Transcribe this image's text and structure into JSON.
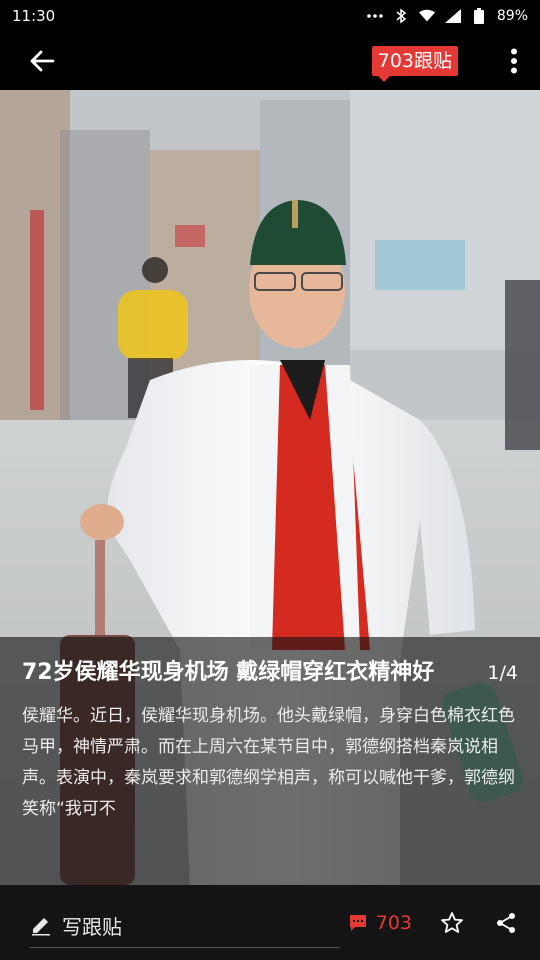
{
  "status_bar": {
    "time": "11:30",
    "battery": "89%",
    "icons": [
      "more-dots-icon",
      "bluetooth-icon",
      "wifi-icon",
      "signal-icon",
      "battery-icon"
    ]
  },
  "top_bar": {
    "back_icon": "back-arrow-icon",
    "comment_badge": "703跟贴",
    "menu_icon": "overflow-menu-icon"
  },
  "caption": {
    "title": "72岁侯耀华现身机场 戴绿帽穿红衣精神好",
    "counter": "1/4",
    "body": "侯耀华。近日，侯耀华现身机场。他头戴绿帽，身穿白色棉衣红色马甲，神情严肃。而在上周六在某节目中，郭德纲搭档秦岚说相声。表演中，秦岚要求和郭德纲学相声，称可以喊他干爹，郭德纲笑称“我可不"
  },
  "bottom_bar": {
    "write_label": "写跟贴",
    "comment_count": "703",
    "icons": [
      "pencil-icon",
      "comment-icon",
      "star-icon",
      "share-icon"
    ]
  },
  "colors": {
    "accent": "#e53935",
    "background": "#000000"
  }
}
